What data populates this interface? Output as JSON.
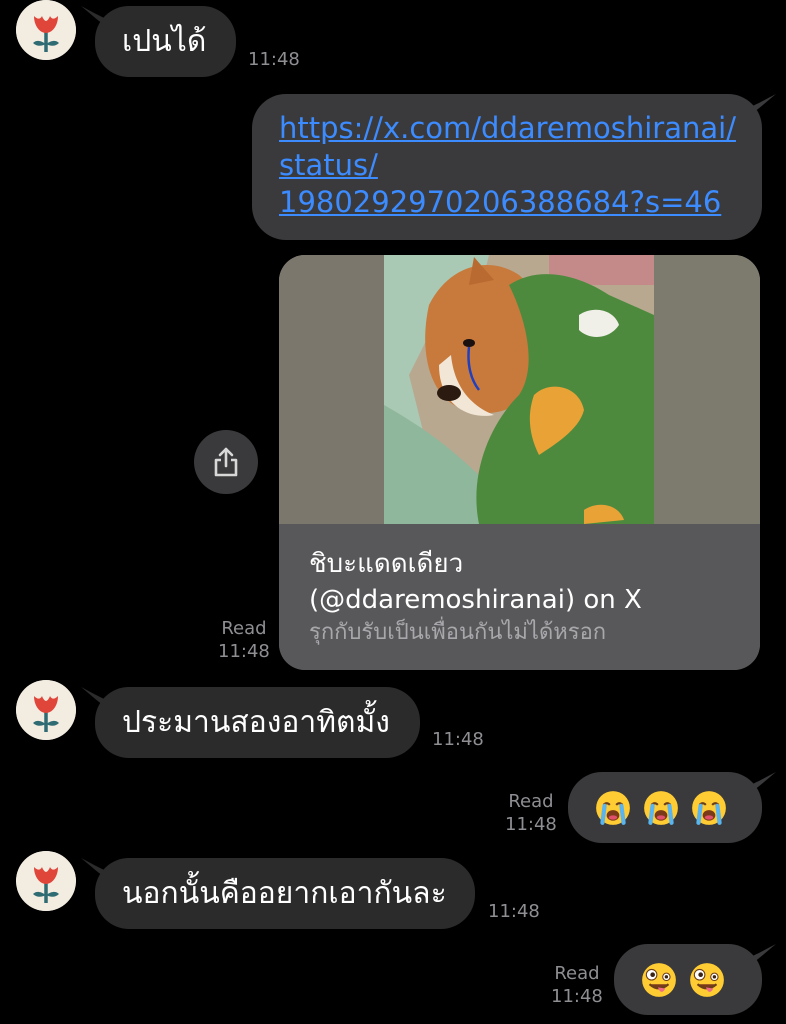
{
  "colors": {
    "background": "#000000",
    "incoming_bubble": "#2b2b2b",
    "outgoing_bubble": "#3a3a3c",
    "link": "#3c8bff",
    "meta_text": "#8e8e93"
  },
  "messages": {
    "m1": {
      "text": "เปนได้",
      "time": "11:48"
    },
    "m2": {
      "link_lines": [
        "https://x.com/ddaremoshiranai/",
        "status/",
        "1980292970206388684?s=46"
      ]
    },
    "m3": {
      "card_title_line1": "ชิบะแดดเดียว",
      "card_title_line2": "(@ddaremoshiranai) on X",
      "card_subtitle": "รุกกับรับเป็นเพื่อนกันไม่ได้หรอก",
      "read_label": "Read",
      "time": "11:48",
      "share_icon": "share-icon"
    },
    "m4": {
      "text": "ประมานสองอาทิตมั้ง",
      "time": "11:48"
    },
    "m5": {
      "emoji": [
        "😭",
        "😭",
        "😭"
      ],
      "emoji_icon": "loudly-crying-face",
      "read_label": "Read",
      "time": "11:48"
    },
    "m6": {
      "text": "นอกนั้นคืออยากเอากันละ",
      "time": "11:48"
    },
    "m7": {
      "emoji": [
        "🤪",
        "🤪"
      ],
      "emoji_icon": "zany-face",
      "read_label": "Read",
      "time": "11:48"
    }
  }
}
